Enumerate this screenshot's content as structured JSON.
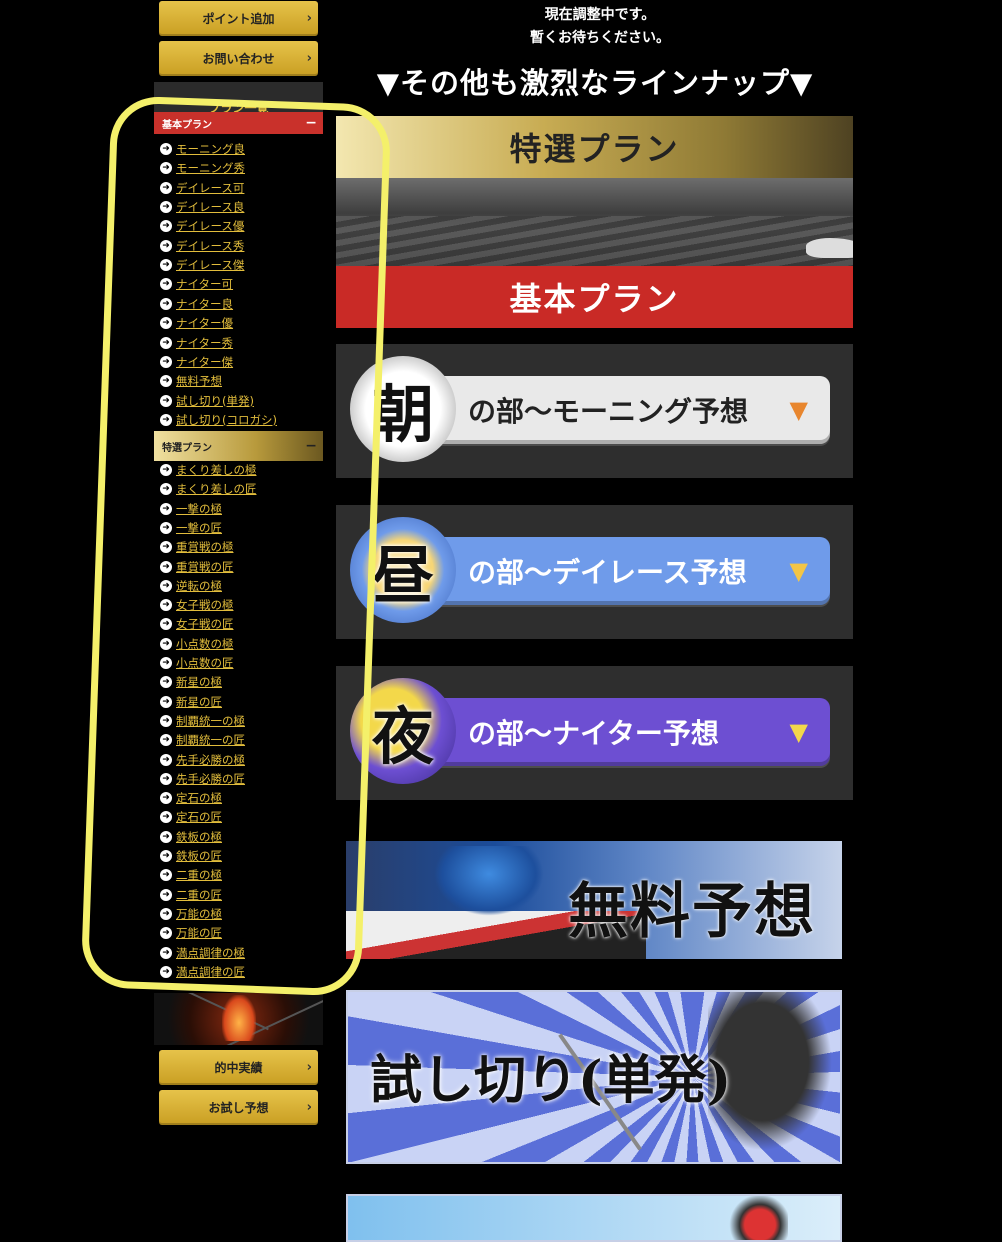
{
  "sidebar": {
    "top_buttons": [
      "ポイント追加",
      "お問い合わせ"
    ],
    "plan_list_title": "プラン一覧",
    "basic_section": {
      "title": "基本プラン",
      "toggle": "−",
      "items": [
        "モーニング良",
        "モーニング秀",
        "デイレース可",
        "デイレース良",
        "デイレース優",
        "デイレース秀",
        "デイレース傑",
        "ナイター可",
        "ナイター良",
        "ナイター優",
        "ナイター秀",
        "ナイター傑",
        "無料予想",
        "試し切り(単発)",
        "試し切り(コロガシ)"
      ]
    },
    "special_section": {
      "title": "特選プラン",
      "toggle": "−",
      "items": [
        "まくり差しの極",
        "まくり差しの匠",
        "一撃の極",
        "一撃の匠",
        "重賞戦の極",
        "重賞戦の匠",
        "逆転の極",
        "女子戦の極",
        "女子戦の匠",
        "小点数の極",
        "小点数の匠",
        "新星の極",
        "新星の匠",
        "制覇統一の極",
        "制覇統一の匠",
        "先手必勝の極",
        "先手必勝の匠",
        "定石の極",
        "定石の匠",
        "鉄板の極",
        "鉄板の匠",
        "二重の極",
        "二重の匠",
        "万能の極",
        "万能の匠",
        "満点調律の極",
        "満点調律の匠"
      ]
    },
    "bottom_buttons": [
      "的中実績",
      "お試し予想"
    ],
    "chevron": "›",
    "item_arrow": "➜"
  },
  "main": {
    "notice_lines": [
      "現在調整中です。",
      "暫くお待ちください。"
    ],
    "lineup_heading": "▼その他も激烈なラインナップ▼",
    "special_plan_banner": "特選プラン",
    "basic_plan_banner": "基本プラン",
    "plans": [
      {
        "kanji": "朝",
        "label": "の部〜モーニング予想",
        "arrow": "▼",
        "color": "#e9e9e9",
        "text_color": "#222",
        "arrow_color": "#e8862e"
      },
      {
        "kanji": "昼",
        "label": "の部〜デイレース予想",
        "arrow": "▼",
        "color": "#6f9bea",
        "text_color": "#ffffff",
        "arrow_color": "#f3c545"
      },
      {
        "kanji": "夜",
        "label": "の部〜ナイター予想",
        "arrow": "▼",
        "color": "#6d4fd2",
        "text_color": "#ffffff",
        "arrow_color": "#f3d84a"
      }
    ],
    "promo_free": "無料予想",
    "promo_trial": "試し切り(単発)"
  },
  "colors": {
    "gold": "#e2bd3c",
    "basic_red": "#c92a26",
    "highlight_yellow": "#f4f06a"
  }
}
